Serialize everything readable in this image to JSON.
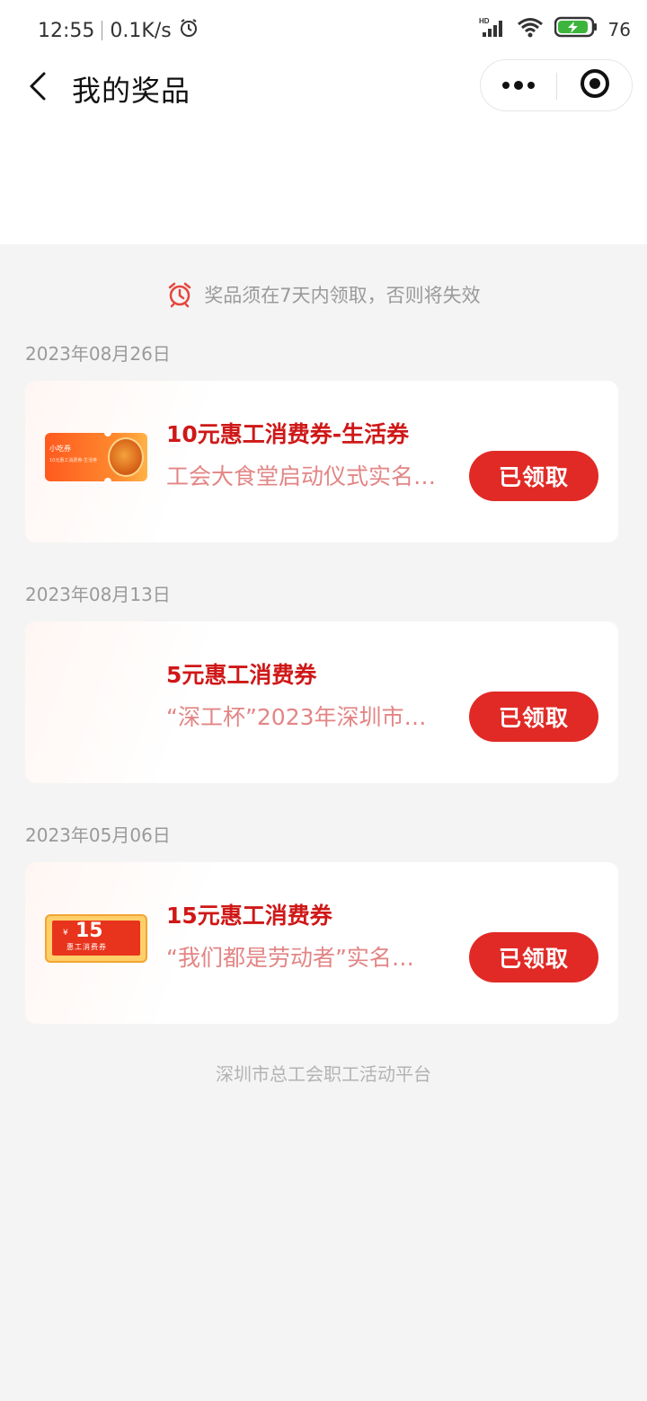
{
  "status_bar": {
    "time": "12:55",
    "speed": "0.1K/s",
    "battery": "76"
  },
  "nav": {
    "title": "我的奖品"
  },
  "notice": {
    "text": "奖品须在7天内领取，否则将失效"
  },
  "groups": [
    {
      "date": "2023年08月26日",
      "prize": {
        "title": "10元惠工消费券-生活券",
        "subtitle": "工会大食堂启动仪式实名…",
        "button": "已领取",
        "thumb_label": "小吃券",
        "thumb_sub": "10元惠工消费券-生活券"
      }
    },
    {
      "date": "2023年08月13日",
      "prize": {
        "title": "5元惠工消费券",
        "subtitle": "“深工杯”2023年深圳市…",
        "button": "已领取"
      }
    },
    {
      "date": "2023年05月06日",
      "prize": {
        "title": "15元惠工消费券",
        "subtitle": "“我们都是劳动者”实名…",
        "button": "已领取",
        "thumb_yen": "¥",
        "thumb_amount": "15",
        "thumb_label": "惠工消费券"
      }
    }
  ],
  "footer": {
    "text": "深圳市总工会职工活动平台"
  },
  "colors": {
    "accent": "#e12a26",
    "title_red": "#cf1818",
    "subtitle_pink": "#e38585",
    "background": "#f4f4f4"
  },
  "icons": [
    "alarm-clock-icon",
    "signal-icon",
    "wifi-icon",
    "battery-icon",
    "back-arrow-icon",
    "more-dots-icon",
    "target-close-icon"
  ]
}
